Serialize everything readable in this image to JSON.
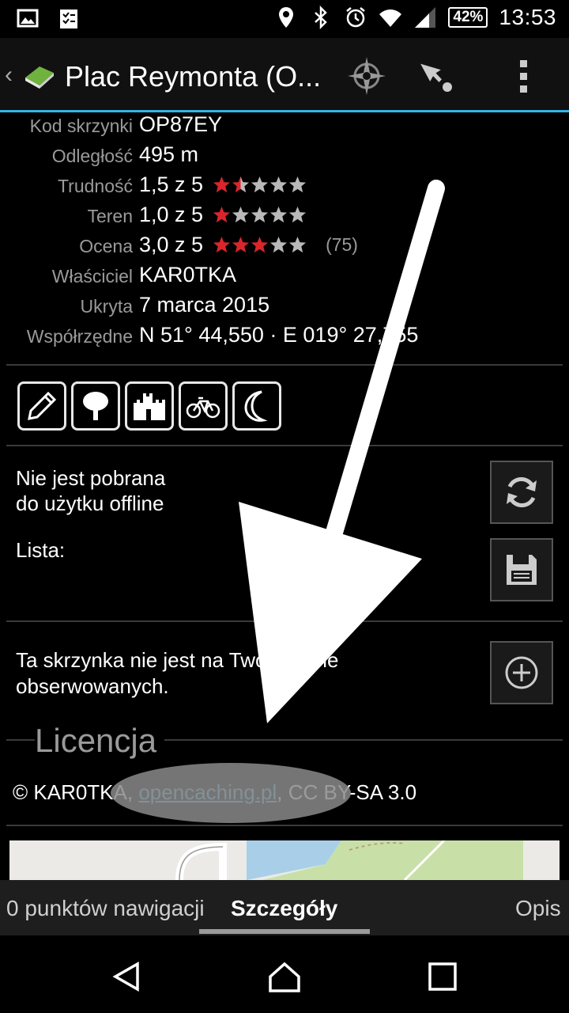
{
  "status_bar": {
    "battery": "42%",
    "time": "13:53",
    "icons": [
      "image-icon",
      "clipboard-icon",
      "location-icon",
      "bluetooth-icon",
      "alarm-icon",
      "wifi-icon",
      "signal-icon"
    ]
  },
  "action_bar": {
    "title": "Plac Reymonta (O...",
    "buttons": [
      "compass-icon",
      "navigate-icon",
      "overflow-menu-icon"
    ]
  },
  "details": [
    {
      "label": "Kod skrzynki",
      "value": "OP87EY"
    },
    {
      "label": "Odległość",
      "value": "495 m"
    },
    {
      "label": "Trudność",
      "value": "1,5 z 5",
      "stars": 1.5
    },
    {
      "label": "Teren",
      "value": "1,0 z 5",
      "stars": 1.0
    },
    {
      "label": "Ocena",
      "value": "3,0 z 5",
      "stars": 3.0,
      "count": "(75)"
    },
    {
      "label": "Właściciel",
      "value": "KAR0TKA"
    },
    {
      "label": "Ukryta",
      "value": "7 marca 2015"
    },
    {
      "label": "Współrzędne",
      "value": "N 51° 44,550 · E 019° 27,755"
    }
  ],
  "attributes": [
    "pencil-icon",
    "tree-icon",
    "castle-icon",
    "bicycle-icon",
    "moon-icon"
  ],
  "offline": {
    "line1": "Nie jest pobrana",
    "line2": "do użytku offline",
    "list_label": "Lista:"
  },
  "watch": {
    "line1": "Ta skrzynka nie jest na Twojej liście",
    "line2": "obserwowanych."
  },
  "license": {
    "title": "Licencja",
    "prefix": "© KAR0TKA, ",
    "link": "opencaching.pl",
    "suffix": ", CC BY-SA 3.0"
  },
  "tabs": {
    "left": "0 punktów nawigacji",
    "active": "Szczegóły",
    "right": "Opis"
  },
  "colors": {
    "accent": "#33b5e5",
    "star_filled": "#d9262a",
    "star_empty": "#b9b9b9",
    "link": "#5fb8e8"
  }
}
